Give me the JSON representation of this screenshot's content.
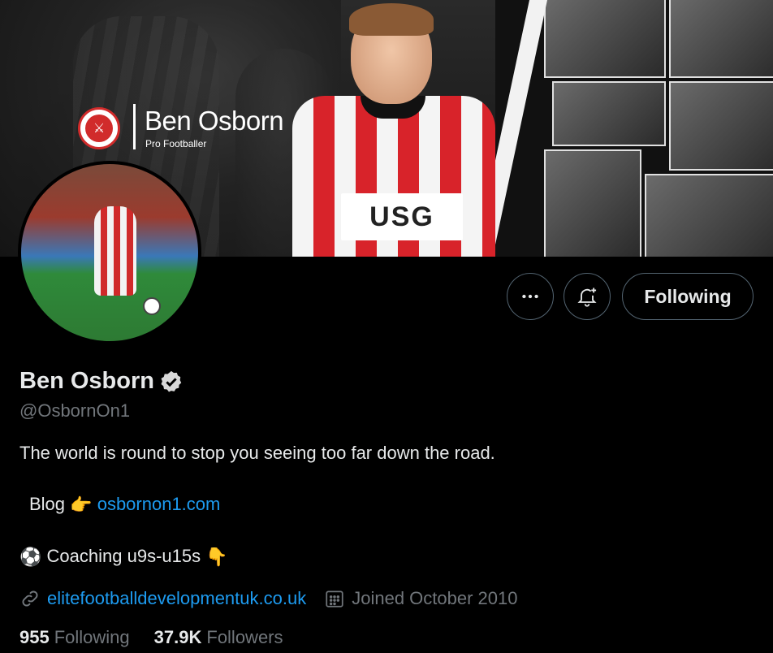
{
  "banner": {
    "brand_name": "Ben Osborn",
    "brand_subtitle": "Pro Footballer",
    "sponsor_text": "USG",
    "crest_symbol": "⚔"
  },
  "actions": {
    "more_icon": "more-horizontal-icon",
    "notify_icon": "bell-plus-icon",
    "follow_label": "Following"
  },
  "profile": {
    "display_name": "Ben Osborn",
    "handle": "@OsbornOn1",
    "verified": true,
    "bio": {
      "line1": "The world is round to stop you seeing too far down the road.",
      "line2_prefix": "Blog",
      "line2_emoji": "👉",
      "line2_link": "osbornon1.com",
      "line3_emoji": "⚽",
      "line3_text": "Coaching u9s-u15s",
      "line3_end_emoji": "👇"
    },
    "website": "elitefootballdevelopmentuk.co.uk",
    "joined": "Joined October 2010"
  },
  "stats": {
    "following_count": "955",
    "following_label": "Following",
    "followers_count": "37.9K",
    "followers_label": "Followers"
  },
  "colors": {
    "accent": "#1d9bf0",
    "muted": "#71767b",
    "background": "#000000",
    "border": "#536471"
  }
}
